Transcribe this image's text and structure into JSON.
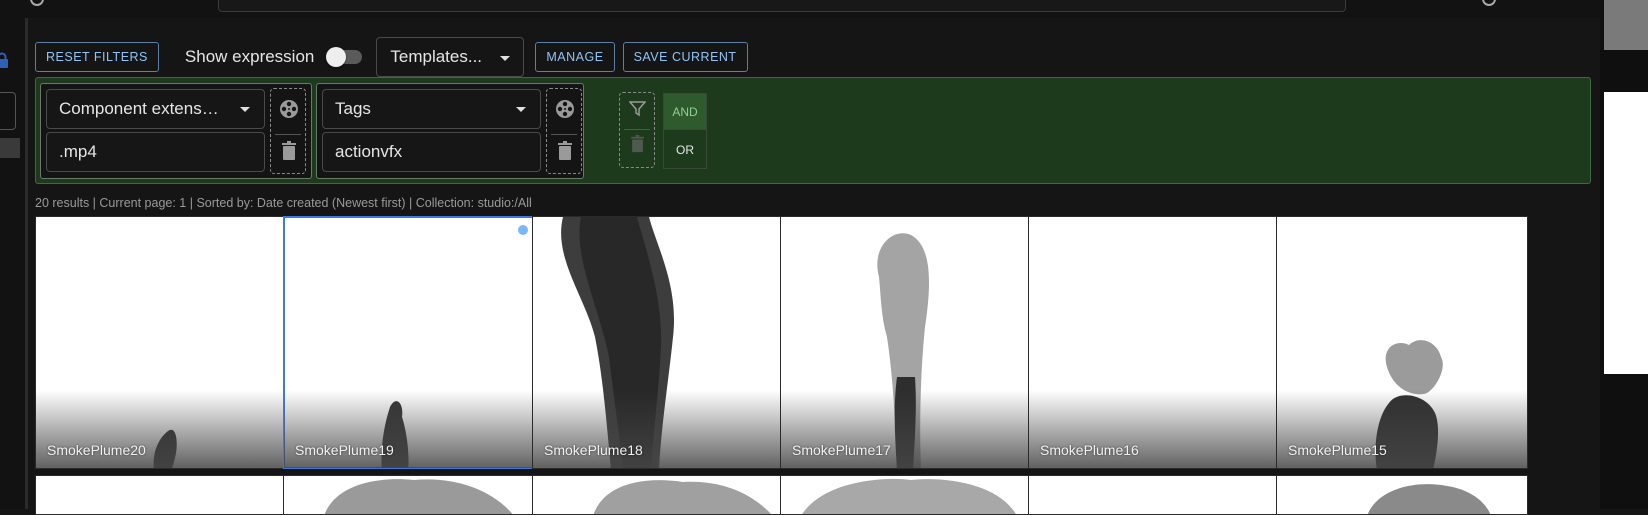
{
  "toolbar": {
    "reset_filters": "RESET FILTERS",
    "show_expression": "Show expression",
    "show_expression_enabled": false,
    "templates_placeholder": "Templates...",
    "manage": "MANAGE",
    "save_current": "SAVE CURRENT"
  },
  "filters": {
    "groups": [
      {
        "field": "Component extens…",
        "value": ".mp4"
      },
      {
        "field": "Tags",
        "value": "actionvfx"
      }
    ],
    "combinator": {
      "and_label": "AND",
      "or_label": "OR",
      "selected": "AND"
    }
  },
  "status_line": "20 results | Current page: 1 | Sorted by: Date created (Newest first) | Collection: studio:/All",
  "results": [
    {
      "name": "SmokePlume20",
      "selected": false
    },
    {
      "name": "SmokePlume19",
      "selected": true
    },
    {
      "name": "SmokePlume18",
      "selected": false
    },
    {
      "name": "SmokePlume17",
      "selected": false
    },
    {
      "name": "SmokePlume16",
      "selected": false
    },
    {
      "name": "SmokePlume15",
      "selected": false
    }
  ],
  "colors": {
    "accent_blue": "#90c4f5",
    "filter_panel_bg": "#1d3a1d",
    "and_active": "#8fd18f",
    "selection_border": "#3d7adb"
  }
}
